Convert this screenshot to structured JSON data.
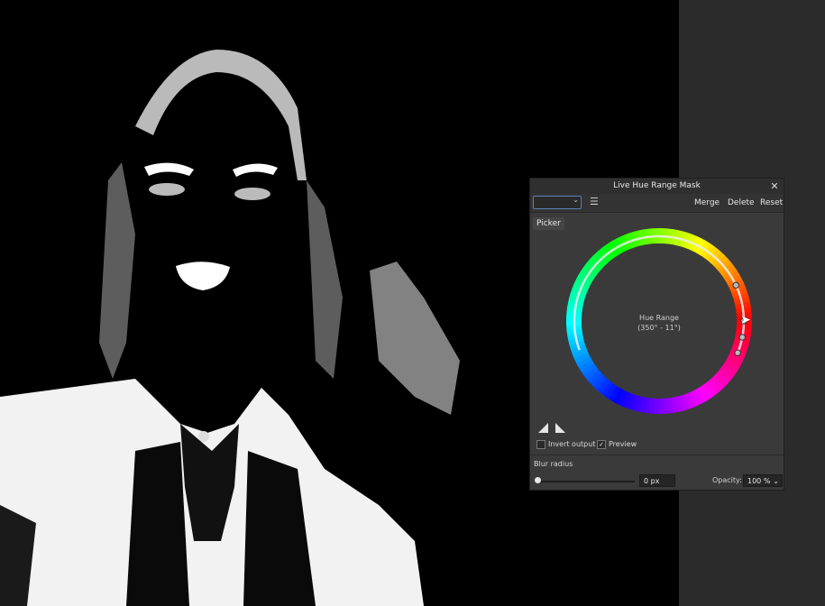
{
  "dialog": {
    "title": "Live Hue Range Mask",
    "close_glyph": "✕",
    "toolbar": {
      "preset_value": "",
      "menu_glyph": "☰",
      "merge_label": "Merge",
      "delete_label": "Delete",
      "reset_label": "Reset"
    },
    "picker_tab": "Picker",
    "hue_range": {
      "title": "Hue Range",
      "range": "(350° - 11°)"
    },
    "invert_output_label": "Invert output",
    "invert_output_checked": false,
    "preview_label": "Preview",
    "preview_checked": true,
    "blur_radius_label": "Blur radius",
    "blur_radius_value": "0 px",
    "opacity_label": "Opacity:",
    "opacity_value": "100 %"
  },
  "icons": {
    "close": "close-icon",
    "chevron": "chevron-down-icon",
    "menu": "hamburger-menu-icon",
    "triangle_left": "mask-triangle-left-icon",
    "triangle_right": "mask-triangle-right-icon",
    "cursor": "mouse-pointer-icon"
  }
}
